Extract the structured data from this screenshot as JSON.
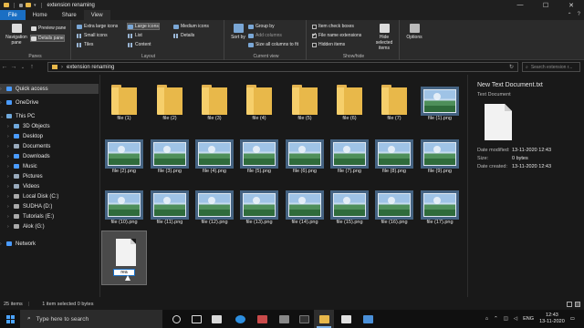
{
  "window": {
    "title": "extension renaming",
    "controls": {
      "minimize": "—",
      "maximize": "☐",
      "close": "✕"
    }
  },
  "tabs": [
    "File",
    "Home",
    "Share",
    "View"
  ],
  "ribbon": {
    "panes": {
      "navigation_pane": "Navigation pane",
      "preview_pane": "Preview pane",
      "details_pane": "Details pane",
      "group_label": "Panes"
    },
    "layout": {
      "extra_large": "Extra large icons",
      "large": "Large icons",
      "medium": "Medium icons",
      "small": "Small icons",
      "list": "List",
      "details": "Details",
      "tiles": "Tiles",
      "content": "Content",
      "group_label": "Layout"
    },
    "current_view": {
      "sort_by": "Sort by",
      "group_by": "Group by",
      "add_columns": "Add columns",
      "size_all_columns": "Size all columns to fit",
      "group_label": "Current view"
    },
    "show_hide": {
      "item_check_boxes": "Item check boxes",
      "file_name_extensions": "File name extensions",
      "hidden_items": "Hidden items",
      "hide_selected": "Hide selected items",
      "group_label": "Show/hide"
    },
    "options": "Options"
  },
  "address": {
    "path": "extension renaming",
    "search_placeholder": "Search extension r..."
  },
  "nav": {
    "items": [
      {
        "label": "Quick access",
        "icon": "star-icon",
        "color": "#4a9bff"
      },
      {
        "label": "OneDrive",
        "icon": "cloud-icon",
        "color": "#4a9bff"
      },
      {
        "label": "This PC",
        "icon": "computer-icon",
        "color": "#6fa8dc"
      },
      {
        "label": "3D Objects",
        "icon": "cube-icon",
        "color": "#6fa8dc"
      },
      {
        "label": "Desktop",
        "icon": "desktop-icon",
        "color": "#4a9bff"
      },
      {
        "label": "Documents",
        "icon": "documents-icon",
        "color": "#9ab"
      },
      {
        "label": "Downloads",
        "icon": "download-icon",
        "color": "#4a9bff"
      },
      {
        "label": "Music",
        "icon": "music-icon",
        "color": "#4a9bff"
      },
      {
        "label": "Pictures",
        "icon": "pictures-icon",
        "color": "#9ab"
      },
      {
        "label": "Videos",
        "icon": "video-icon",
        "color": "#9ab"
      },
      {
        "label": "Local Disk (C:)",
        "icon": "drive-icon",
        "color": "#aaa"
      },
      {
        "label": "SUDHA (D:)",
        "icon": "drive-icon",
        "color": "#aaa"
      },
      {
        "label": "Tutorials (E:)",
        "icon": "drive-icon",
        "color": "#aaa"
      },
      {
        "label": "Alok (G:)",
        "icon": "drive-icon",
        "color": "#aaa"
      },
      {
        "label": "Network",
        "icon": "network-icon",
        "color": "#4a9bff"
      }
    ]
  },
  "files": {
    "row1": [
      "file (1)",
      "file (2)",
      "file (3)",
      "file (4)",
      "file (5)",
      "file (6)",
      "file (7)",
      "file (1).png"
    ],
    "row2": [
      "file (2).png",
      "file (3).png",
      "file (4).png",
      "file (5).png",
      "file (6).png",
      "file (7).png",
      "file (8).png",
      "file (9).png"
    ],
    "row3": [
      "file (10).png",
      "file (11).png",
      "file (12).png",
      "file (13).png",
      "file (14).png",
      "file (15).png",
      "file (16).png",
      "file (17).png"
    ],
    "editing_name": "rea"
  },
  "details": {
    "name": "New Text Document.txt",
    "type": "Text Document",
    "date_modified_label": "Date modified:",
    "date_modified": "13-11-2020 12:43",
    "size_label": "Size:",
    "size": "0 bytes",
    "date_created_label": "Date created:",
    "date_created": "13-11-2020 12:43"
  },
  "status": {
    "count": "25 items",
    "selection": "1 item selected 0 bytes"
  },
  "taskbar": {
    "search_placeholder": "Type here to search",
    "lang": "ENG",
    "time": "12:43",
    "date": "13-11-2020"
  }
}
